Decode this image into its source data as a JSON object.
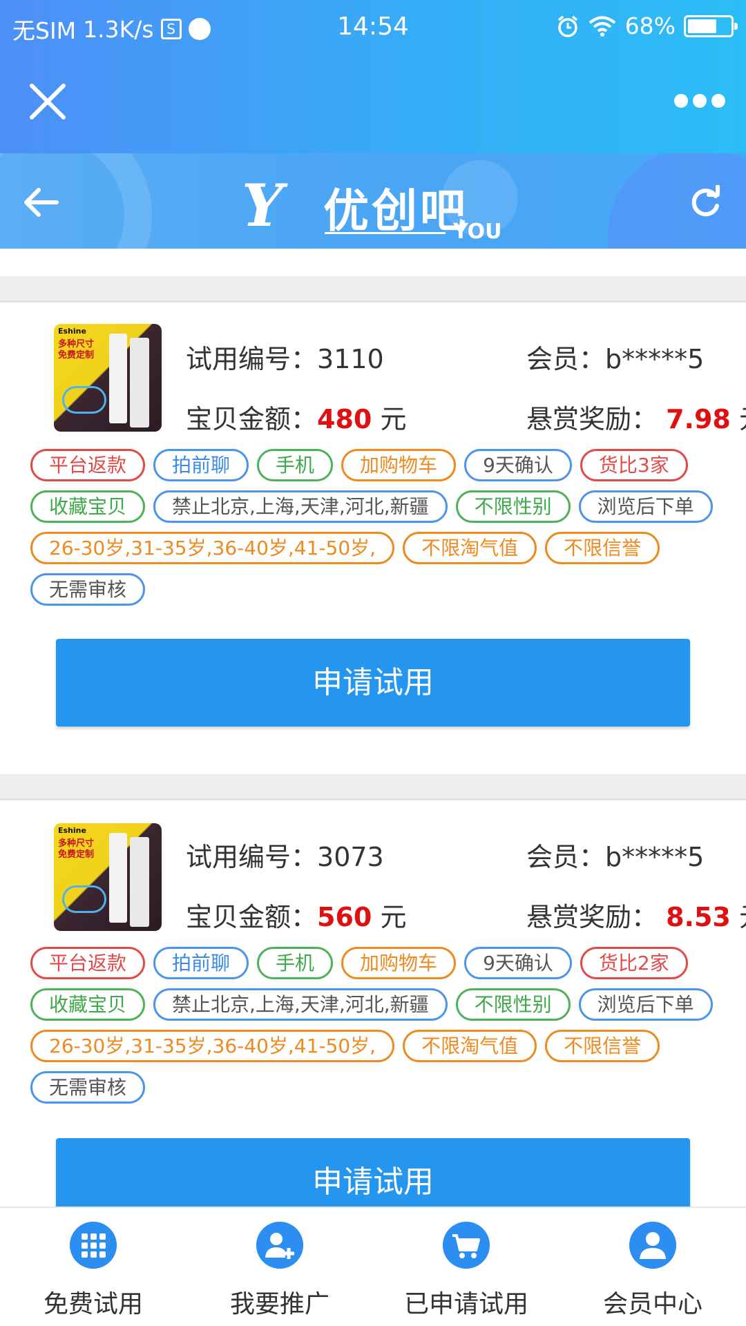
{
  "status_bar": {
    "carrier": "无SIM",
    "speed": "1.3K/s",
    "time": "14:54",
    "battery": "68%",
    "battery_level": 0.68
  },
  "banner": {
    "logo_mark": "Y",
    "logo_text": "优创吧",
    "logo_sub": "YOU"
  },
  "labels": {
    "trial_id": "试用编号：",
    "member": "会员：",
    "amount": "宝贝金额：",
    "reward": "悬赏奖励：",
    "currency": "元"
  },
  "thumb": {
    "brand": "Eshine",
    "promo_line1": "多种尺寸",
    "promo_line2": "免费定制"
  },
  "cards": [
    {
      "trial_id": "3110",
      "member": "b*****5",
      "amount": "480",
      "reward": "7.98",
      "apply_label": "申请试用",
      "tags": [
        {
          "text": "平台返款",
          "style": "red"
        },
        {
          "text": "拍前聊",
          "style": "blue"
        },
        {
          "text": "手机",
          "style": "green"
        },
        {
          "text": "加购物车",
          "style": "orange"
        },
        {
          "text": "9天确认",
          "style": "blue-gray"
        },
        {
          "text": "货比3家",
          "style": "red"
        },
        {
          "text": "收藏宝贝",
          "style": "green"
        },
        {
          "text": "禁止北京,上海,天津,河北,新疆",
          "style": "blue-gray"
        },
        {
          "text": "不限性别",
          "style": "green"
        },
        {
          "text": "浏览后下单",
          "style": "blue-gray"
        },
        {
          "text": "26-30岁,31-35岁,36-40岁,41-50岁,",
          "style": "orange"
        },
        {
          "text": "不限淘气值",
          "style": "orange"
        },
        {
          "text": "不限信誉",
          "style": "orange"
        },
        {
          "text": "无需审核",
          "style": "blue-gray"
        }
      ]
    },
    {
      "trial_id": "3073",
      "member": "b*****5",
      "amount": "560",
      "reward": "8.53",
      "apply_label": "申请试用",
      "tags": [
        {
          "text": "平台返款",
          "style": "red"
        },
        {
          "text": "拍前聊",
          "style": "blue"
        },
        {
          "text": "手机",
          "style": "green"
        },
        {
          "text": "加购物车",
          "style": "orange"
        },
        {
          "text": "9天确认",
          "style": "blue-gray"
        },
        {
          "text": "货比2家",
          "style": "red"
        },
        {
          "text": "收藏宝贝",
          "style": "green"
        },
        {
          "text": "禁止北京,上海,天津,河北,新疆",
          "style": "blue-gray"
        },
        {
          "text": "不限性别",
          "style": "green"
        },
        {
          "text": "浏览后下单",
          "style": "blue-gray"
        },
        {
          "text": "26-30岁,31-35岁,36-40岁,41-50岁,",
          "style": "orange"
        },
        {
          "text": "不限淘气值",
          "style": "orange"
        },
        {
          "text": "不限信誉",
          "style": "orange"
        },
        {
          "text": "无需审核",
          "style": "blue-gray"
        }
      ]
    }
  ],
  "bottom_nav": [
    {
      "label": "免费试用",
      "icon": "grid-icon"
    },
    {
      "label": "我要推广",
      "icon": "add-user-icon"
    },
    {
      "label": "已申请试用",
      "icon": "cart-icon"
    },
    {
      "label": "会员中心",
      "icon": "user-icon"
    }
  ],
  "colors": {
    "header_gradient_start": "#4e8ff7",
    "header_gradient_end": "#2bbdf6",
    "primary_button": "#2596ef",
    "price_red": "#e01010",
    "nav_icon": "#2b8ef0"
  }
}
